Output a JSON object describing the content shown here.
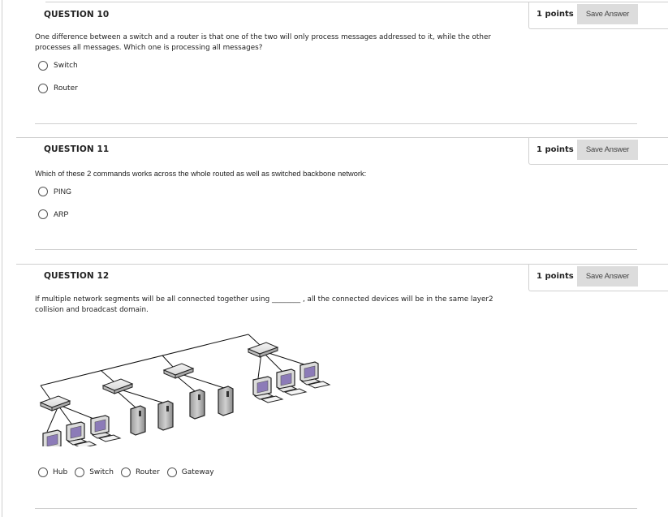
{
  "questions": [
    {
      "title": "QUESTION 10",
      "points": "1 points",
      "save_label": "Save Answer",
      "text": "One difference between a switch and a router is that one of the two will only process messages addressed to it, while the other processes all messages. Which one is processing all messages?",
      "options": [
        "Switch",
        "Router"
      ],
      "selected": null
    },
    {
      "title": "QUESTION 11",
      "points": "1 points",
      "save_label": "Save Answer",
      "text": "Which of these 2 commands works across the whole routed as well as switched backbone network:",
      "options": [
        "PING",
        "ARP"
      ],
      "selected": null
    },
    {
      "title": "QUESTION 12",
      "points": "1 points",
      "save_label": "Save Answer",
      "text": "If multiple network segments will be all connected together using ________ , all the connected devices will be in the same layer2 collision and broadcast domain.",
      "image": "network-topology-diagram",
      "options": [
        "Hub",
        "Switch",
        "Router",
        "Gateway"
      ],
      "selected": null
    }
  ],
  "colors": {
    "button_bg": "#dcdcdc",
    "rule": "#cfcfcf",
    "monitor_screen": "#8c7bb8"
  }
}
